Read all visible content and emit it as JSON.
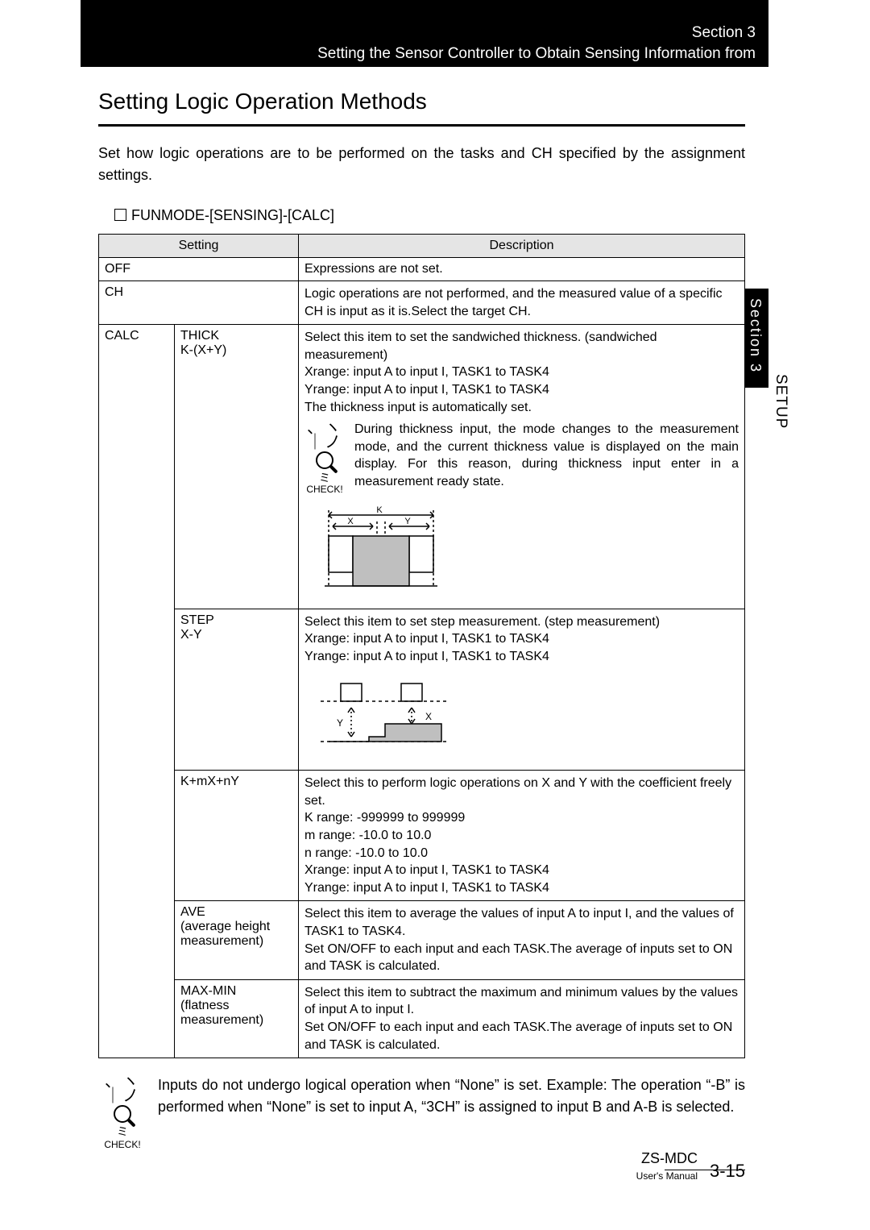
{
  "header": {
    "section": "Section 3",
    "chapter": "Setting the Sensor Controller to Obtain Sensing Information from"
  },
  "sidebar": {
    "tab": "Section 3",
    "label": "SETUP"
  },
  "title": "Setting Logic Operation Methods",
  "intro": "Set how logic operations are to be performed on the tasks and CH specified by the assignment settings.",
  "funmode": "FUNMODE-[SENSING]-[CALC]",
  "table": {
    "headers": {
      "setting": "Setting",
      "description": "Description"
    },
    "rows": {
      "off": {
        "setting": "OFF",
        "desc": "Expressions are not set."
      },
      "ch": {
        "setting": "CH",
        "desc": "Logic operations are not performed, and the measured value of a specific CH is input as it is.Select the target CH."
      },
      "calc_label": "CALC",
      "thick": {
        "name": "THICK",
        "formula": "K-(X+Y)",
        "l1": "Select this item to set the sandwiched thickness. (sandwiched measurement)",
        "l2": "Xrange: input A to input I, TASK1 to TASK4",
        "l3": "Yrange: input A to input I, TASK1 to TASK4",
        "l4": "The thickness input is automatically set.",
        "note": "During thickness input, the mode changes to the measurement mode, and the current thickness value is displayed on the main display. For this reason, during thickness input enter in a measurement ready state."
      },
      "step": {
        "name": "STEP",
        "formula": "X-Y",
        "l1": "Select this item to set step measurement. (step measurement)",
        "l2": "Xrange: input A to input I, TASK1 to TASK4",
        "l3": "Yrange: input A to input I, TASK1 to TASK4"
      },
      "kmxny": {
        "name": "K+mX+nY",
        "l1": "Select this to perform logic operations on X and Y with the coefficient freely set.",
        "l2": "K range: -999999 to 999999",
        "l3": "m range: -10.0 to 10.0",
        "l4": "n range: -10.0 to 10.0",
        "l5": "Xrange: input A to input I, TASK1 to TASK4",
        "l6": "Yrange: input A to input I, TASK1 to TASK4"
      },
      "ave": {
        "name": "AVE",
        "sub": "(average height measurement)",
        "l1": "Select this item to average the values of input A to input I, and the values of TASK1 to TASK4.",
        "l2": "Set ON/OFF to each input and each TASK.The average of inputs set to ON and TASK is calculated."
      },
      "maxmin": {
        "name": "MAX-MIN",
        "sub": "(flatness measurement)",
        "l1": "Select this item to subtract the maximum and minimum values by the values of input A to input I.",
        "l2": "Set ON/OFF to each input and each TASK.The average of inputs set to ON and TASK is calculated."
      }
    }
  },
  "check_label": "CHECK!",
  "footnote": "Inputs do not undergo logical operation when “None” is set. Example: The operation “-B” is performed when “None” is set to input A, “3CH” is assigned to input B and A-B is selected.",
  "footer": {
    "product": "ZS-MDC",
    "manual": "User's Manual",
    "page": "3-15"
  },
  "diagrams": {
    "thick": {
      "K": "K",
      "X": "X",
      "Y": "Y"
    },
    "step": {
      "X": "X",
      "Y": "Y"
    }
  }
}
